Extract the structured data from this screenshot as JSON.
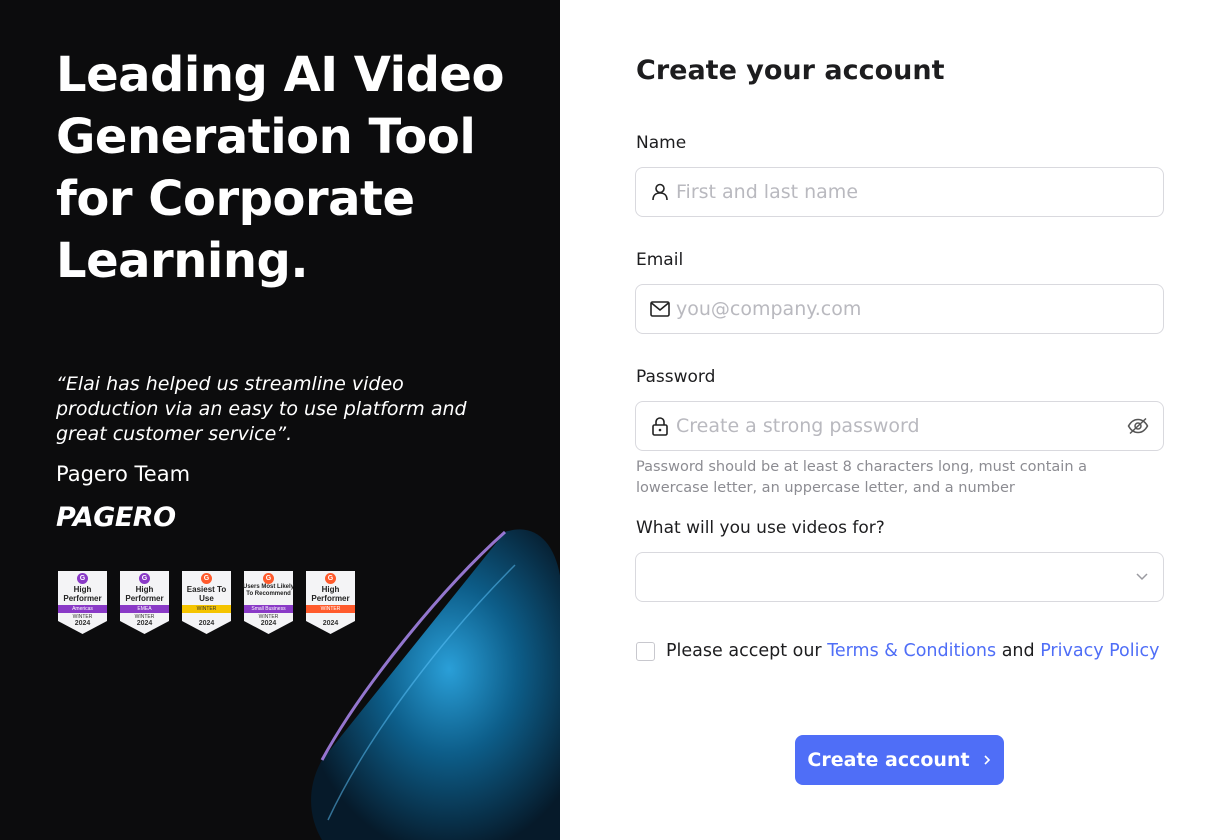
{
  "hero": {
    "headline": "Leading AI Video Generation Tool for Corporate Learning.",
    "quote": "“Elai has helped us streamline video production via an easy to use platform and great customer service”.",
    "author": "Pagero Team",
    "brand": "PAGERO"
  },
  "badges": [
    {
      "title": "High Performer",
      "strip": "Americas",
      "season": "WINTER",
      "year": "2024",
      "color": "#8a3ac7"
    },
    {
      "title": "High Performer",
      "strip": "EMEA",
      "season": "WINTER",
      "year": "2024",
      "color": "#8a3ac7"
    },
    {
      "title": "Easiest To Use",
      "strip": "WINTER",
      "season": "",
      "year": "2024",
      "color": "#f5c400"
    },
    {
      "title": "Users Most Likely To Recommend",
      "strip": "Small Business",
      "season": "WINTER",
      "year": "2024",
      "color": "#8a3ac7"
    },
    {
      "title": "High Performer",
      "strip": "WINTER",
      "season": "",
      "year": "2024",
      "color": "#ff5a2c"
    }
  ],
  "form": {
    "title": "Create your account",
    "name_label": "Name",
    "name_placeholder": "First and last name",
    "email_label": "Email",
    "email_placeholder": "you@company.com",
    "password_label": "Password",
    "password_placeholder": "Create a strong password",
    "password_hint": "Password should be at least 8 characters long, must contain a lowercase letter, an uppercase letter, and a number",
    "use_label": "What will you use videos for?",
    "use_value": "",
    "terms_prefix": "Please accept our ",
    "terms_link": "Terms & Conditions",
    "terms_and": " and ",
    "privacy_link": "Privacy Policy",
    "submit_label": "Create account",
    "submit_icon": "chevron-right-icon"
  },
  "colors": {
    "accent": "#4f6ef7",
    "left_bg": "#0c0c0d"
  }
}
